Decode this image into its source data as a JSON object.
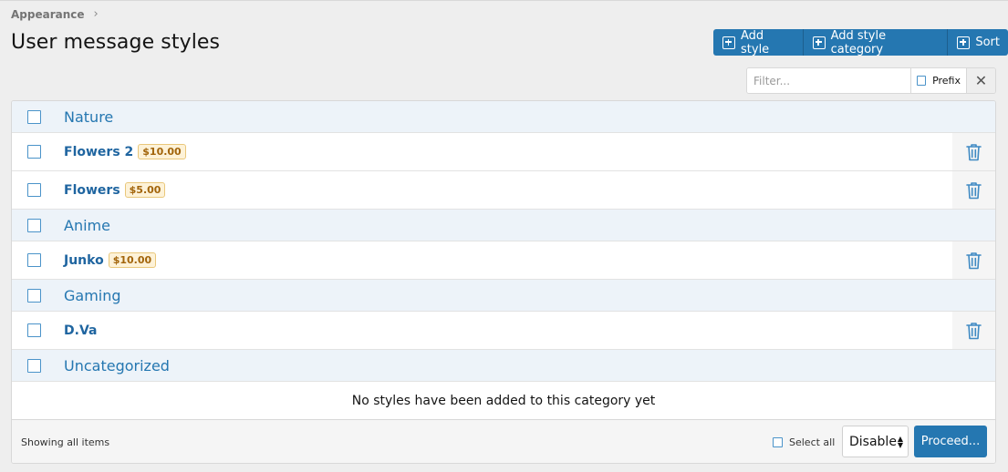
{
  "breadcrumb": {
    "item": "Appearance",
    "separator": "›"
  },
  "page_title": "User message styles",
  "toolbar": {
    "add_style": "Add style",
    "add_style_category": "Add style category",
    "sort": "Sort"
  },
  "filter": {
    "placeholder": "Filter...",
    "prefix_label": "Prefix",
    "clear": "✕"
  },
  "list": {
    "categories": [
      {
        "name": "Nature",
        "items": [
          {
            "name": "Flowers 2",
            "price": "$10.00"
          },
          {
            "name": "Flowers",
            "price": "$5.00"
          }
        ]
      },
      {
        "name": "Anime",
        "items": [
          {
            "name": "Junko",
            "price": "$10.00"
          }
        ]
      },
      {
        "name": "Gaming",
        "items": [
          {
            "name": "D.Va"
          }
        ]
      },
      {
        "name": "Uncategorized",
        "items": [],
        "empty_text": "No styles have been added to this category yet"
      }
    ]
  },
  "footer": {
    "showing": "Showing all items",
    "select_all": "Select all",
    "action_select": "Disable",
    "proceed": "Proceed..."
  },
  "colors": {
    "accent": "#2577b1",
    "category_bg": "#edf3f9",
    "badge_text": "#a2640a",
    "badge_bg": "#fdf2d8"
  }
}
